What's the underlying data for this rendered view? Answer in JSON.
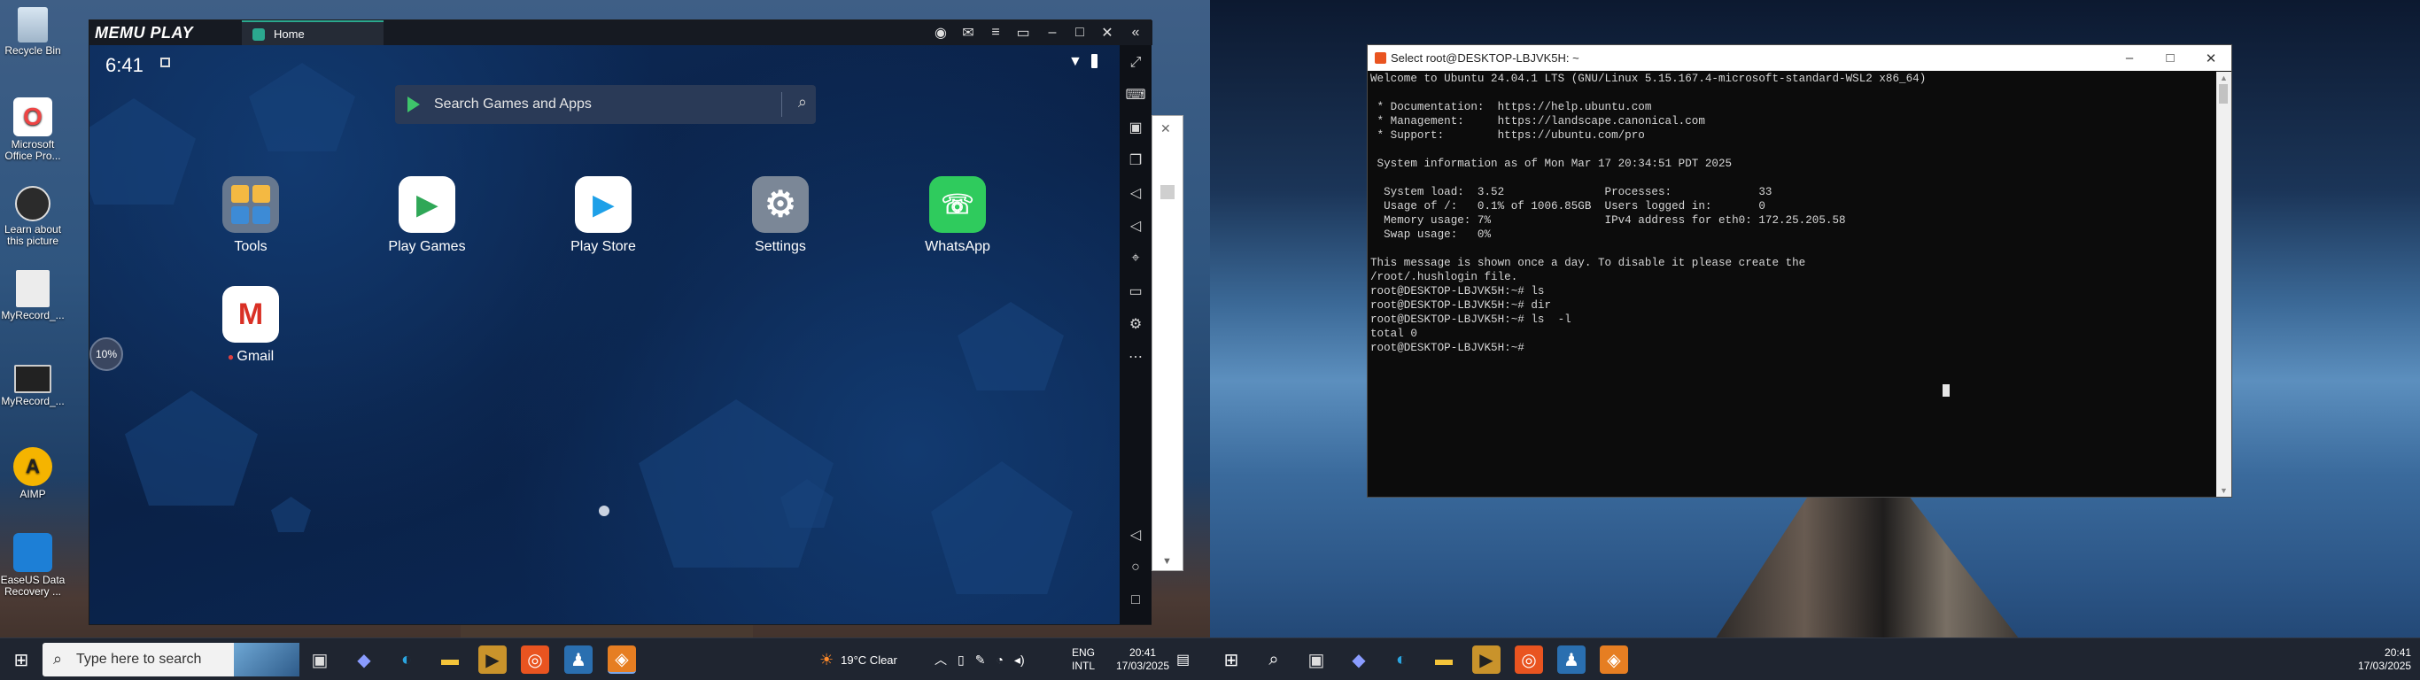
{
  "desktop": {
    "icons": [
      {
        "label": "Recycle Bin",
        "icon": "recycle-bin-icon"
      },
      {
        "label": "Microsoft Office Pro...",
        "icon": "office-icon"
      },
      {
        "label": "Learn about this picture",
        "icon": "learn-icon"
      },
      {
        "label": "MyRecord_...",
        "icon": "video-file-icon"
      },
      {
        "label": "MyRecord_...",
        "icon": "monitor-icon"
      },
      {
        "label": "AIMP",
        "icon": "aimp-icon"
      },
      {
        "label": "EaseUS Data Recovery ...",
        "icon": "easeus-icon"
      }
    ]
  },
  "memu": {
    "logo": "MEMU PLAY",
    "tab_label": "Home",
    "android": {
      "time": "6:41",
      "search_placeholder": "Search Games and Apps",
      "apps": [
        {
          "label": "Tools",
          "icon": "tools-folder-icon"
        },
        {
          "label": "Play Games",
          "icon": "play-games-icon"
        },
        {
          "label": "Play Store",
          "icon": "play-store-icon"
        },
        {
          "label": "Settings",
          "icon": "settings-gear-icon"
        },
        {
          "label": "WhatsApp",
          "icon": "whatsapp-icon"
        },
        {
          "label": "Gmail",
          "icon": "gmail-icon"
        }
      ],
      "side_badge": "10%"
    }
  },
  "terminal": {
    "title": "Select root@DESKTOP-LBJVK5H: ~",
    "lines": [
      "Welcome to Ubuntu 24.04.1 LTS (GNU/Linux 5.15.167.4-microsoft-standard-WSL2 x86_64)",
      "",
      " * Documentation:  https://help.ubuntu.com",
      " * Management:     https://landscape.canonical.com",
      " * Support:        https://ubuntu.com/pro",
      "",
      " System information as of Mon Mar 17 20:34:51 PDT 2025",
      "",
      "  System load:  3.52               Processes:             33",
      "  Usage of /:   0.1% of 1006.85GB  Users logged in:       0",
      "  Memory usage: 7%                 IPv4 address for eth0: 172.25.205.58",
      "  Swap usage:   0%",
      "",
      "This message is shown once a day. To disable it please create the",
      "/root/.hushlogin file.",
      "root@DESKTOP-LBJVK5H:~# ls",
      "root@DESKTOP-LBJVK5H:~# dir",
      "root@DESKTOP-LBJVK5H:~# ls  -l",
      "total 0",
      "root@DESKTOP-LBJVK5H:~#"
    ]
  },
  "taskbar": {
    "search_placeholder": "Type here to search",
    "weather": "19°C  Clear",
    "lang_top": "ENG",
    "lang_bottom": "INTL",
    "time": "20:41",
    "date": "17/03/2025"
  },
  "taskbar2": {
    "time": "20:41",
    "date": "17/03/2025"
  },
  "colors": {
    "accent": "#2ba88f",
    "ubuntu": "#e95420"
  }
}
